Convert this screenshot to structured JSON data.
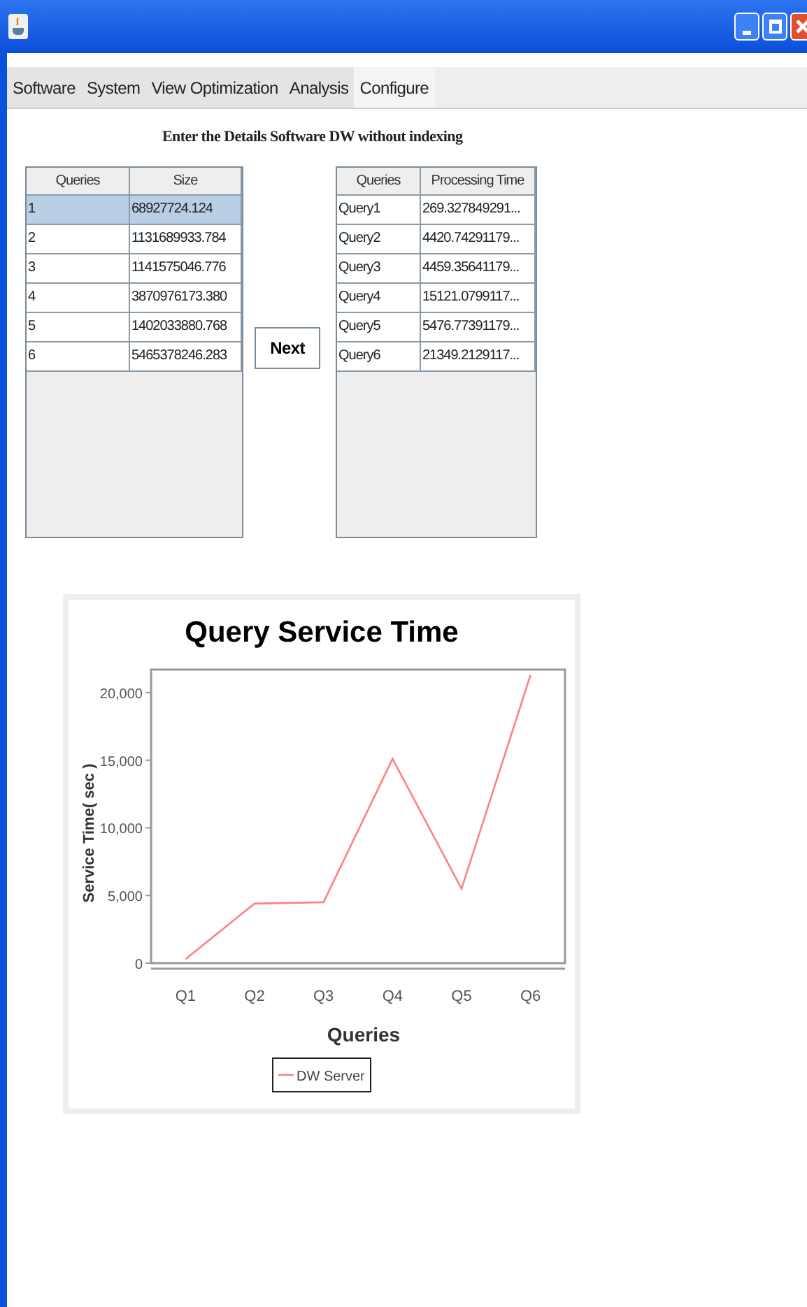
{
  "menu": [
    {
      "label": "Software",
      "selected": false
    },
    {
      "label": "System",
      "selected": false
    },
    {
      "label": "View Optimization",
      "selected": false
    },
    {
      "label": "Analysis",
      "selected": false
    },
    {
      "label": "Configure",
      "selected": true
    }
  ],
  "heading": "Enter the Details Software DW without indexing",
  "size_table": {
    "columns": [
      "Queries",
      "Size"
    ],
    "rows": [
      {
        "cells": [
          "1",
          "68927724.124"
        ],
        "selected": true
      },
      {
        "cells": [
          "2",
          "1131689933.784"
        ],
        "selected": false
      },
      {
        "cells": [
          "3",
          "1141575046.776"
        ],
        "selected": false
      },
      {
        "cells": [
          "4",
          "3870976173.380"
        ],
        "selected": false
      },
      {
        "cells": [
          "5",
          "1402033880.768"
        ],
        "selected": false
      },
      {
        "cells": [
          "6",
          "5465378246.283"
        ],
        "selected": false
      }
    ]
  },
  "next_button": "Next",
  "time_table": {
    "columns": [
      "Queries",
      "Processing Time"
    ],
    "rows": [
      {
        "cells": [
          "Query1",
          "269.327849291..."
        ],
        "selected": false
      },
      {
        "cells": [
          "Query2",
          "4420.74291179..."
        ],
        "selected": false
      },
      {
        "cells": [
          "Query3",
          "4459.35641179..."
        ],
        "selected": false
      },
      {
        "cells": [
          "Query4",
          "15121.0799117..."
        ],
        "selected": false
      },
      {
        "cells": [
          "Query5",
          "5476.77391179..."
        ],
        "selected": false
      },
      {
        "cells": [
          "Query6",
          "21349.2129117..."
        ],
        "selected": false
      }
    ]
  },
  "chart": {
    "chart_data": {
      "type": "line",
      "title": "Query Service Time",
      "xlabel": "Queries",
      "ylabel": "Service Time( sec )",
      "categories": [
        "Q1",
        "Q2",
        "Q3",
        "Q4",
        "Q5",
        "Q6"
      ],
      "series": [
        {
          "name": "DW Server",
          "color": "#ff8080",
          "values": [
            300,
            4400,
            4500,
            15100,
            5500,
            21300
          ]
        }
      ],
      "ylim": [
        0,
        21700
      ],
      "yticks": [
        {
          "value": 0,
          "label": "0"
        },
        {
          "value": 5000,
          "label": "5,000"
        },
        {
          "value": 10000,
          "label": "10,000"
        },
        {
          "value": 15000,
          "label": "15,000"
        },
        {
          "value": 20000,
          "label": "20,000"
        }
      ]
    }
  }
}
